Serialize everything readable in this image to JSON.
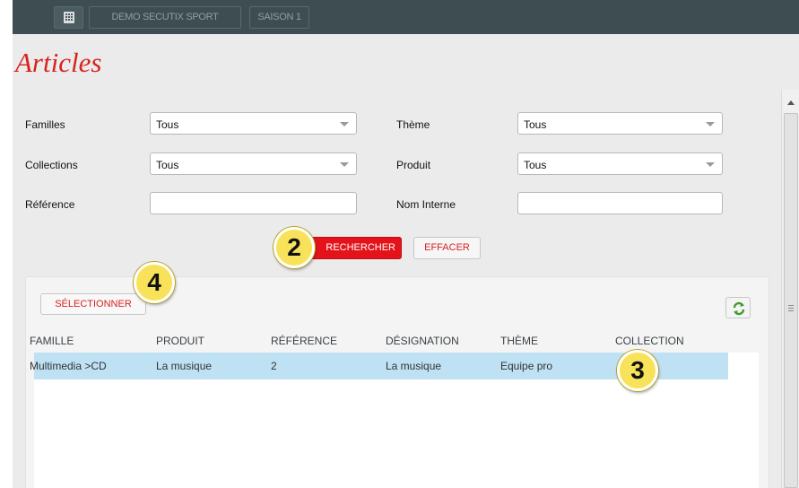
{
  "topbar": {
    "home_icon": "building-icon",
    "organization": "DEMO SECUTIX SPORT",
    "season": "SAISON 1"
  },
  "page": {
    "title": "Articles"
  },
  "filters": {
    "familles": {
      "label": "Familles",
      "value": "Tous"
    },
    "theme": {
      "label": "Thème",
      "value": "Tous"
    },
    "collections": {
      "label": "Collections",
      "value": "Tous"
    },
    "produit": {
      "label": "Produit",
      "value": "Tous"
    },
    "reference": {
      "label": "Référence",
      "value": ""
    },
    "nom_interne": {
      "label": "Nom Interne",
      "value": ""
    }
  },
  "actions": {
    "search_label": "RECHERCHER",
    "clear_label": "EFFACER"
  },
  "results": {
    "select_label": "SÉLECTIONNER",
    "refresh_icon": "refresh-icon",
    "columns": [
      "FAMILLE",
      "PRODUIT",
      "RÉFÉRENCE",
      "DÉSIGNATION",
      "THÈME",
      "COLLECTION"
    ],
    "rows": [
      [
        "Multimedia >CD",
        "La musique",
        "2",
        "La musique",
        "Equipe pro",
        ""
      ]
    ]
  },
  "callouts": [
    "2",
    "4",
    "3"
  ],
  "colors": {
    "accent": "#d7231f",
    "topbar": "#3e4d52",
    "row_selected": "#bfe1f4",
    "callout": "#f8e25a"
  }
}
